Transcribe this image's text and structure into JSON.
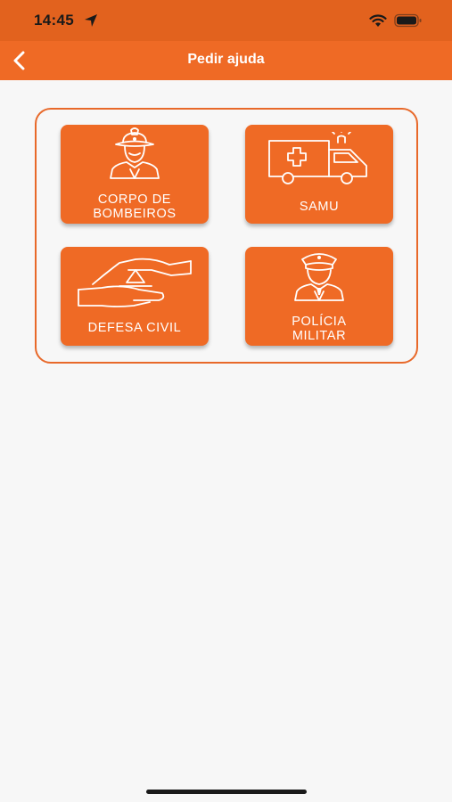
{
  "status_bar": {
    "time": "14:45"
  },
  "nav": {
    "title": "Pedir ajuda",
    "back_icon": "chevron-left-icon"
  },
  "tiles": [
    {
      "label": "CORPO DE\nBOMBEIROS",
      "icon": "firefighter-icon"
    },
    {
      "label": "SAMU",
      "icon": "ambulance-icon"
    },
    {
      "label": "DEFESA CIVIL",
      "icon": "hands-triangle-icon"
    },
    {
      "label": "POLÍCIA\nMILITAR",
      "icon": "police-officer-icon"
    }
  ],
  "colors": {
    "status_bar": "#e2621e",
    "nav_bar": "#ef6a25",
    "tile": "#ef6a25",
    "panel_border": "#e8692a",
    "background": "#f7f7f7"
  }
}
